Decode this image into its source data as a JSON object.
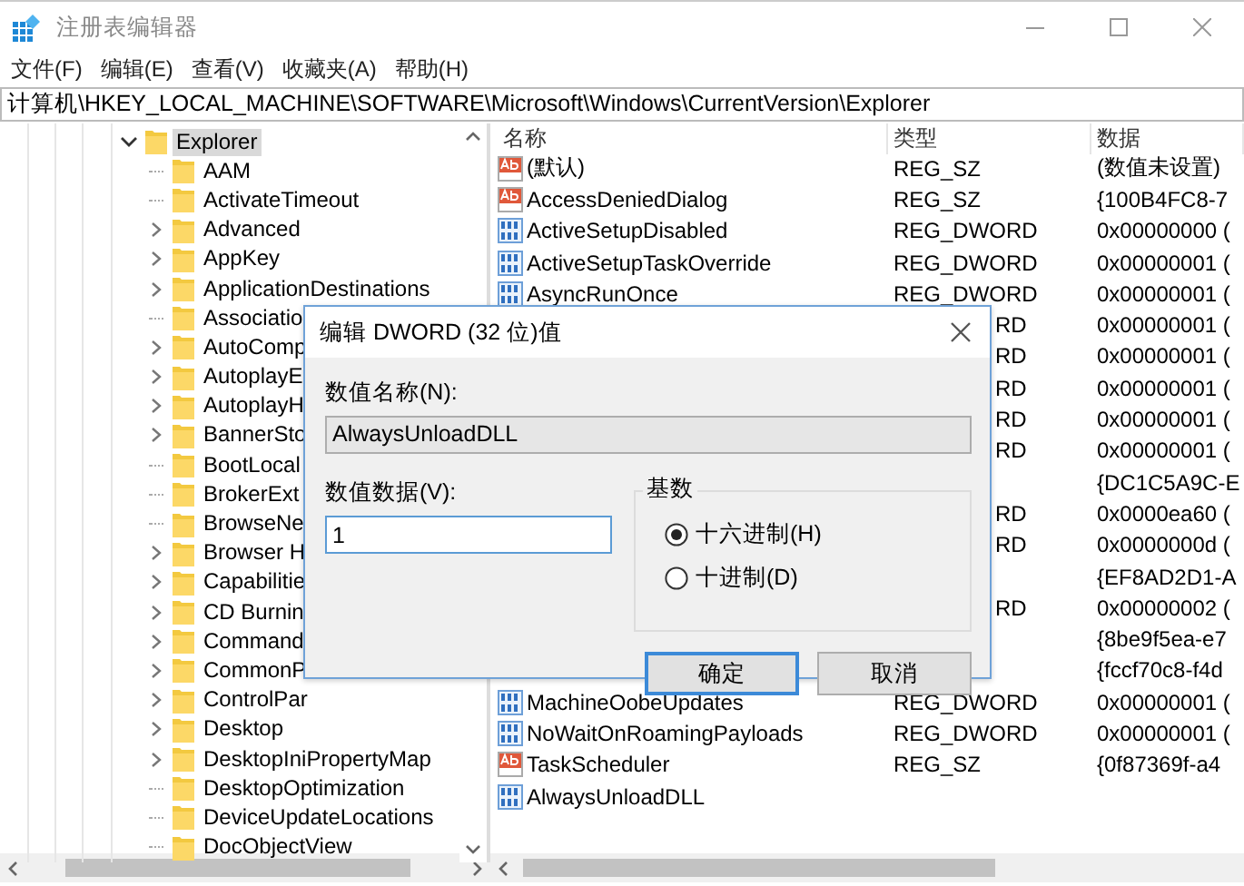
{
  "window": {
    "title": "注册表编辑器"
  },
  "menu": [
    "文件(F)",
    "编辑(E)",
    "查看(V)",
    "收藏夹(A)",
    "帮助(H)"
  ],
  "address": "计算机\\HKEY_LOCAL_MACHINE\\SOFTWARE\\Microsoft\\Windows\\CurrentVersion\\Explorer",
  "tree": {
    "label": "Explorer",
    "expanded": true,
    "selected": true,
    "children": [
      {
        "label": "AAM",
        "expandable": false
      },
      {
        "label": "ActivateTimeout",
        "expandable": false
      },
      {
        "label": "Advanced",
        "expandable": true
      },
      {
        "label": "AppKey",
        "expandable": true
      },
      {
        "label": "ApplicationDestinations",
        "expandable": true
      },
      {
        "label": "Associatio",
        "expandable": false
      },
      {
        "label": "AutoComp",
        "expandable": true
      },
      {
        "label": "AutoplayE",
        "expandable": true
      },
      {
        "label": "AutoplayH",
        "expandable": true
      },
      {
        "label": "BannerSto",
        "expandable": true
      },
      {
        "label": "BootLocal",
        "expandable": false
      },
      {
        "label": "BrokerExt",
        "expandable": false
      },
      {
        "label": "BrowseNe",
        "expandable": false
      },
      {
        "label": "Browser H",
        "expandable": true
      },
      {
        "label": "Capabilitie",
        "expandable": true
      },
      {
        "label": "CD Burnin",
        "expandable": true
      },
      {
        "label": "Command",
        "expandable": true
      },
      {
        "label": "CommonP",
        "expandable": true
      },
      {
        "label": "ControlPar",
        "expandable": true
      },
      {
        "label": "Desktop",
        "expandable": true
      },
      {
        "label": "DesktopIniPropertyMap",
        "expandable": true
      },
      {
        "label": "DesktopOptimization",
        "expandable": false
      },
      {
        "label": "DeviceUpdateLocations",
        "expandable": false
      },
      {
        "label": "DocObjectView",
        "expandable": false
      }
    ]
  },
  "list": {
    "columns": [
      "名称",
      "类型",
      "数据"
    ],
    "rows": [
      {
        "kind": "string",
        "name": "(默认)",
        "type": "REG_SZ",
        "data": "(数值未设置)"
      },
      {
        "kind": "string",
        "name": "AccessDeniedDialog",
        "type": "REG_SZ",
        "data": "{100B4FC8-7"
      },
      {
        "kind": "dword",
        "name": "ActiveSetupDisabled",
        "type": "REG_DWORD",
        "data": "0x00000000 ("
      },
      {
        "kind": "dword",
        "name": "ActiveSetupTaskOverride",
        "type": "REG_DWORD",
        "data": "0x00000001 ("
      },
      {
        "kind": "dword",
        "name": "AsyncRunOnce",
        "type": "REG_DWORD",
        "data": "0x00000001 ("
      },
      {
        "covered": true,
        "type": "RD",
        "data": "0x00000001 ("
      },
      {
        "covered": true,
        "type": "RD",
        "data": "0x00000001 ("
      },
      {
        "covered": true,
        "type": "RD",
        "data": "0x00000001 ("
      },
      {
        "covered": true,
        "type": "RD",
        "data": "0x00000001 ("
      },
      {
        "covered": true,
        "type": "RD",
        "data": "0x00000001 ("
      },
      {
        "covered": true,
        "data": "{DC1C5A9C-E"
      },
      {
        "covered": true,
        "type": "RD",
        "data": "0x0000ea60 ("
      },
      {
        "covered": true,
        "type": "RD",
        "data": "0x0000000d ("
      },
      {
        "covered": true,
        "data": "{EF8AD2D1-A"
      },
      {
        "covered": true,
        "type": "RD",
        "data": "0x00000002 ("
      },
      {
        "covered": true,
        "data": "{8be9f5ea-e7"
      },
      {
        "covered": true,
        "data": "{fccf70c8-f4d"
      },
      {
        "kind": "dword",
        "name": "MachineOobeUpdates",
        "type": "REG_DWORD",
        "data": "0x00000001 ("
      },
      {
        "kind": "dword",
        "name": "NoWaitOnRoamingPayloads",
        "type": "REG_DWORD",
        "data": "0x00000001 ("
      },
      {
        "kind": "string",
        "name": "TaskScheduler",
        "type": "REG_SZ",
        "data": "{0f87369f-a4"
      },
      {
        "kind": "dword",
        "name": "AlwaysUnloadDLL"
      }
    ]
  },
  "dialog": {
    "title": "编辑 DWORD (32 位)值",
    "name_label": "数值名称(N):",
    "name_value": "AlwaysUnloadDLL",
    "data_label": "数值数据(V):",
    "data_value": "1",
    "base_label": "基数",
    "bases": [
      {
        "label": "十六进制(H)",
        "selected": true
      },
      {
        "label": "十进制(D)",
        "selected": false
      }
    ],
    "buttons": [
      {
        "label": "确定",
        "default": true
      },
      {
        "label": "取消",
        "default": false
      }
    ]
  }
}
